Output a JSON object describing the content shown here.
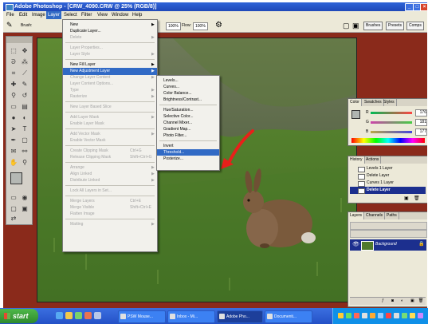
{
  "window": {
    "title": "Adobe Photoshop - [CRW_4090.CRW @ 25% (RGB/8)]",
    "controls": [
      "_",
      "□",
      "×"
    ]
  },
  "menubar": {
    "items": [
      "File",
      "Edit",
      "Image",
      "Layer",
      "Select",
      "Filter",
      "View",
      "Window",
      "Help"
    ],
    "active": "Layer"
  },
  "options_bar": {
    "brush_label": "Brush:",
    "mode_value": "Normal",
    "opacity_label": "Opacity:",
    "opacity_value": "100%",
    "flow_label": "Flow:",
    "flow_value": "100%",
    "palette_tabs": [
      "Brushes",
      "Presets",
      "Comps"
    ]
  },
  "layer_menu": {
    "items": [
      {
        "label": "New",
        "submenu": true,
        "disabled": false
      },
      {
        "label": "Duplicate Layer...",
        "disabled": false
      },
      {
        "label": "Delete",
        "submenu": true,
        "disabled": true
      },
      {
        "separator": true
      },
      {
        "label": "Layer Properties...",
        "disabled": true
      },
      {
        "label": "Layer Style",
        "submenu": true,
        "disabled": true
      },
      {
        "separator": true
      },
      {
        "label": "New Fill Layer",
        "submenu": true,
        "disabled": false
      },
      {
        "label": "New Adjustment Layer",
        "submenu": true,
        "disabled": false,
        "highlighted": true
      },
      {
        "label": "Change Layer Content",
        "submenu": true,
        "disabled": true
      },
      {
        "label": "Layer Content Options...",
        "disabled": true
      },
      {
        "label": "Type",
        "submenu": true,
        "disabled": true
      },
      {
        "label": "Rasterize",
        "submenu": true,
        "disabled": true
      },
      {
        "separator": true
      },
      {
        "label": "New Layer Based Slice",
        "disabled": true
      },
      {
        "separator": true
      },
      {
        "label": "Add Layer Mask",
        "submenu": true,
        "disabled": true
      },
      {
        "label": "Enable Layer Mask",
        "disabled": true
      },
      {
        "separator": true
      },
      {
        "label": "Add Vector Mask",
        "submenu": true,
        "disabled": true
      },
      {
        "label": "Enable Vector Mask",
        "disabled": true
      },
      {
        "separator": true
      },
      {
        "label": "Create Clipping Mask",
        "shortcut": "Ctrl+G",
        "disabled": true
      },
      {
        "label": "Release Clipping Mask",
        "shortcut": "Shift+Ctrl+G",
        "disabled": true
      },
      {
        "separator": true
      },
      {
        "label": "Arrange",
        "submenu": true,
        "disabled": true
      },
      {
        "label": "Align Linked",
        "submenu": true,
        "disabled": true
      },
      {
        "label": "Distribute Linked",
        "submenu": true,
        "disabled": true
      },
      {
        "separator": true
      },
      {
        "label": "Lock All Layers in Set...",
        "disabled": true
      },
      {
        "separator": true
      },
      {
        "label": "Merge Layers",
        "shortcut": "Ctrl+E",
        "disabled": true
      },
      {
        "label": "Merge Visible",
        "shortcut": "Shift+Ctrl+E",
        "disabled": true
      },
      {
        "label": "Flatten Image",
        "disabled": true
      },
      {
        "separator": true
      },
      {
        "label": "Matting",
        "submenu": true,
        "disabled": true
      }
    ]
  },
  "adjustment_submenu": {
    "items": [
      {
        "label": "Levels..."
      },
      {
        "label": "Curves..."
      },
      {
        "label": "Color Balance..."
      },
      {
        "label": "Brightness/Contrast..."
      },
      {
        "separator": true
      },
      {
        "label": "Hue/Saturation..."
      },
      {
        "label": "Selective Color..."
      },
      {
        "label": "Channel Mixer..."
      },
      {
        "label": "Gradient Map..."
      },
      {
        "label": "Photo Filter..."
      },
      {
        "separator": true
      },
      {
        "label": "Invert"
      },
      {
        "label": "Threshold...",
        "highlighted": true
      },
      {
        "label": "Posterize..."
      }
    ]
  },
  "color_panel": {
    "tabs": [
      "Color",
      "Swatches",
      "Styles"
    ],
    "channels": [
      {
        "name": "R",
        "value": "176"
      },
      {
        "name": "G",
        "value": "181"
      },
      {
        "name": "B",
        "value": "177"
      }
    ]
  },
  "history_panel": {
    "tabs": [
      "History",
      "Actions"
    ],
    "items": [
      "Levels 1 Layer",
      "Delete Layer",
      "Curves 1 Layer",
      "Delete Layer"
    ],
    "selected_index": 3
  },
  "layers_panel": {
    "tabs": [
      "Layers",
      "Channels",
      "Paths"
    ],
    "layer_name": "Background"
  },
  "taskbar": {
    "start_label": "start",
    "buttons": [
      {
        "label": "PSW Mouse..."
      },
      {
        "label": "Inbox - Mi..."
      },
      {
        "label": "Adobe Pho...",
        "active": true
      },
      {
        "label": "Documenti..."
      }
    ]
  },
  "colors": {
    "titlebar": "#2f64d8",
    "workspace": "#8a2a1b",
    "menu_highlight": "#316ac5",
    "history_selected": "#1c2f8e",
    "arrow": "#e8201a",
    "start_button": "#3e9c3a"
  }
}
